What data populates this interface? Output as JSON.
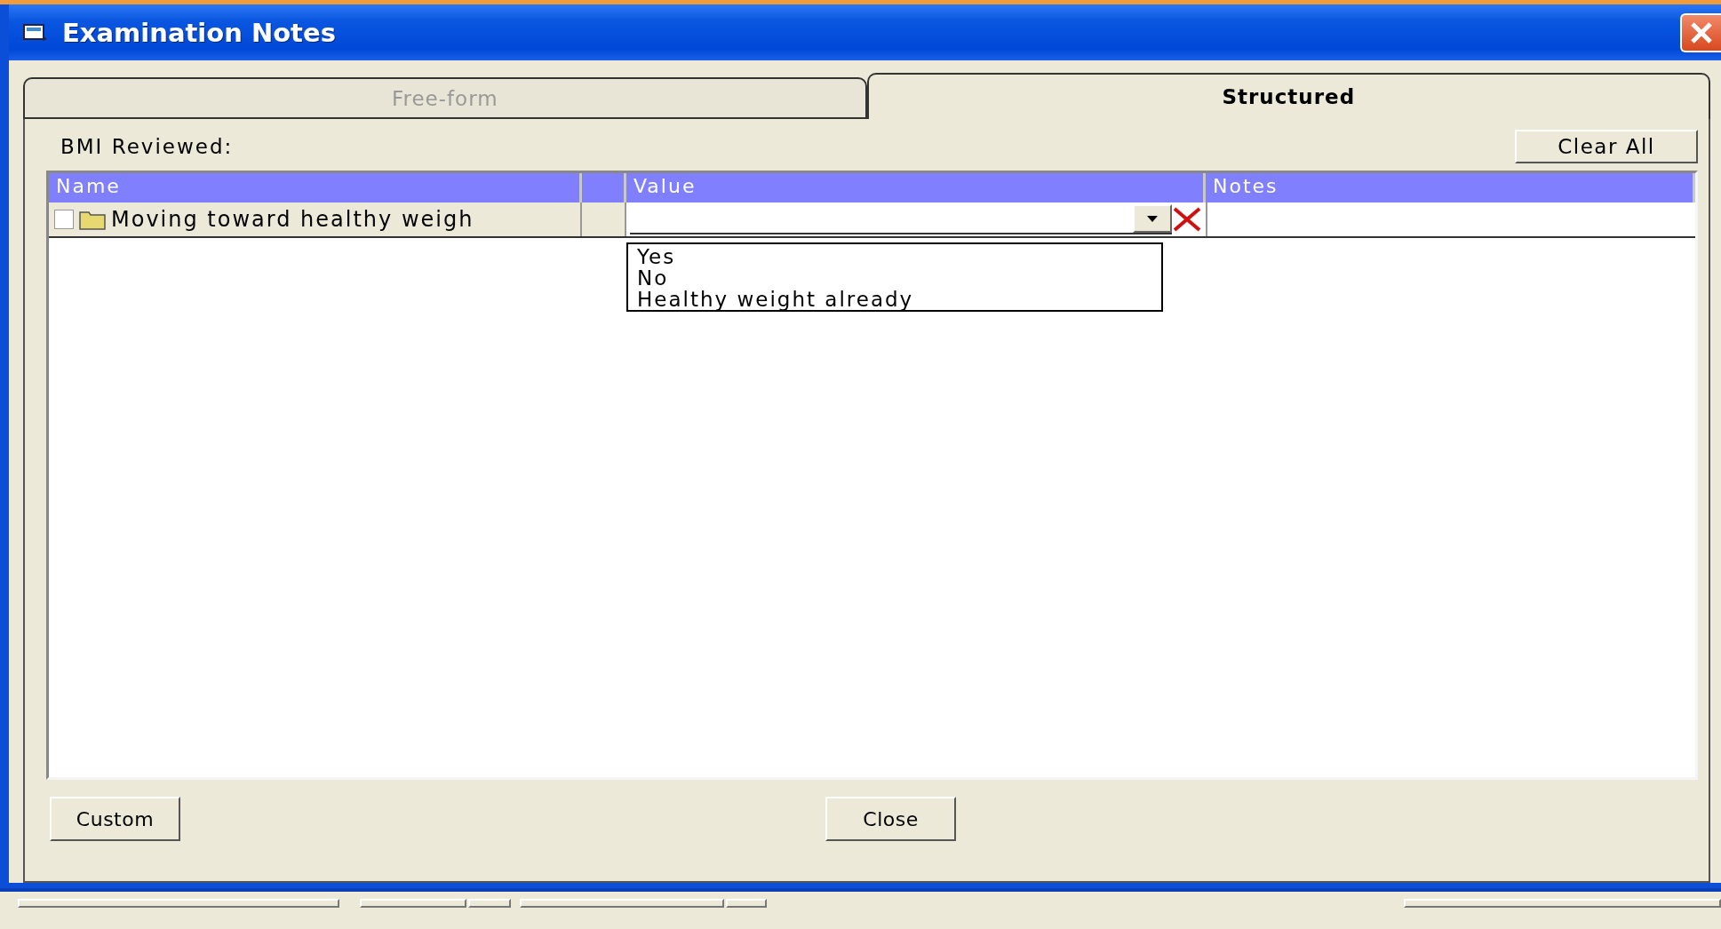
{
  "window": {
    "title": "Examination Notes"
  },
  "tabs": [
    {
      "label": "Free-form",
      "selected": false
    },
    {
      "label": "Structured",
      "selected": true
    }
  ],
  "section_label": "BMI Reviewed:",
  "clear_button": "Clear All",
  "grid": {
    "columns": [
      {
        "kind": "text",
        "label": "Name"
      },
      {
        "kind": "spacer"
      },
      {
        "kind": "text",
        "label": "Value"
      },
      {
        "kind": "text",
        "label": "Notes"
      }
    ],
    "rows": [
      {
        "name": "Moving toward healthy weigh",
        "checked": false
      }
    ],
    "dropdown": {
      "expanded": true,
      "options": [
        "Yes",
        "No",
        "Healthy weight already"
      ]
    }
  },
  "buttons": [
    {
      "label": "Custom"
    },
    {
      "label": "Close"
    }
  ]
}
